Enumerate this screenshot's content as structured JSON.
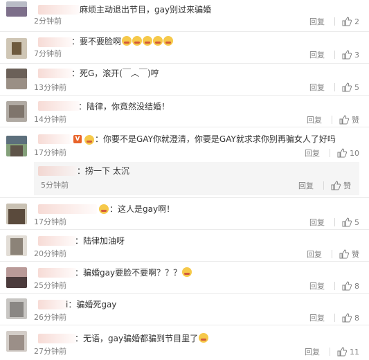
{
  "reply_label": "回复",
  "like_label": "赞",
  "comments": [
    {
      "text": "麻烦主动退出节目，gay别过来骗婚",
      "time": "2分钟前",
      "likes": "2"
    },
    {
      "text": "：要不要脸啊",
      "time": "7分钟前",
      "likes": "3"
    },
    {
      "text": "：死G，滚开(￣︿￣)哼",
      "time": "13分钟前",
      "likes": "5"
    },
    {
      "text": "：陆律，你竟然没结婚！",
      "time": "14分钟前",
      "likes": "赞"
    },
    {
      "text": "：你要不是GAY你就澄清，你要是GAY就求求你别再骗女人了好吗",
      "time": "17分钟前",
      "likes": "10",
      "reply": {
        "text": "：捞一下 太沉",
        "time": "5分钟前",
        "likes": "赞"
      }
    },
    {
      "text": "：这人是gay啊！",
      "time": "17分钟前",
      "likes": "5"
    },
    {
      "text": "：陆律加油呀",
      "time": "20分钟前",
      "likes": "赞"
    },
    {
      "text": "：骗婚gay要脸不要啊？？？",
      "time": "25分钟前",
      "likes": "8"
    },
    {
      "text": "i：骗婚死gay",
      "time": "26分钟前",
      "likes": "8"
    },
    {
      "text": "：无语，gay骗婚都骗到节目里了",
      "time": "27分钟前",
      "likes": "11"
    }
  ]
}
